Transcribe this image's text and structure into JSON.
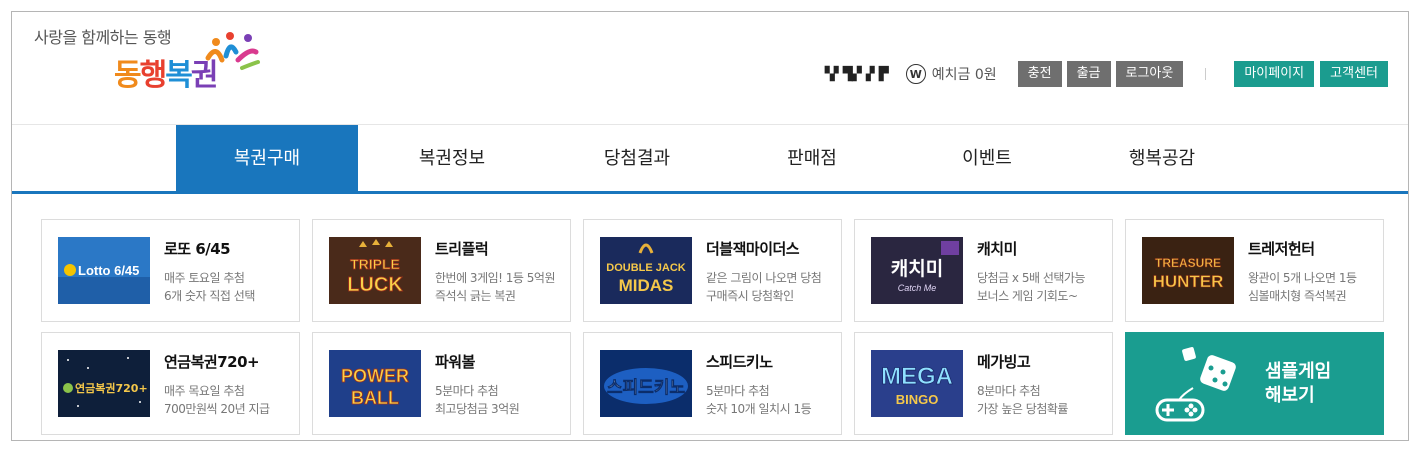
{
  "header": {
    "slogan": "사랑을 함께하는 동행",
    "brand": [
      "동",
      "행",
      "복",
      "권"
    ],
    "user_name": "▚▘▜▞▗▘▛",
    "deposit_icon": "W",
    "deposit_label": "예치금 0원",
    "buttons": [
      "충전",
      "출금",
      "로그아웃"
    ],
    "links": [
      "마이페이지",
      "고객센터"
    ]
  },
  "nav": {
    "items": [
      "복권구매",
      "복권정보",
      "당첨결과",
      "판매점",
      "이벤트",
      "행복공감"
    ],
    "active_index": 0,
    "accent_color": "#1976bd"
  },
  "games": [
    {
      "title": "로또 6/45",
      "line1": "매주 토요일 추첨",
      "line2": "6개 숫자 직접 선택",
      "logo_text": "Lotto 6/45"
    },
    {
      "title": "트리플럭",
      "line1": "한번에 3게임! 1등 5억원",
      "line2": "즉석식 긁는 복권",
      "logo_text": [
        "TRIPLE",
        "LUCK"
      ]
    },
    {
      "title": "더블잭마이더스",
      "line1": "같은 그림이 나오면 당첨",
      "line2": "구매즉시 당첨확인",
      "logo_text": [
        "DOUBLE JACK",
        "MIDAS"
      ]
    },
    {
      "title": "캐치미",
      "line1": "당첨금 x 5배 선택가능",
      "line2": "보너스 게임 기회도~",
      "logo_text": [
        "캐치미",
        "Catch Me"
      ]
    },
    {
      "title": "트레저헌터",
      "line1": "왕관이 5개 나오면 1등",
      "line2": "심볼매치형 즉석복권",
      "logo_text": [
        "TREASURE",
        "HUNTER"
      ]
    },
    {
      "title": "연금복권720+",
      "line1": "매주 목요일 추첨",
      "line2": "700만원씩 20년 지급",
      "logo_text": "연금복권720+"
    },
    {
      "title": "파워볼",
      "line1": "5분마다 추첨",
      "line2": "최고당첨금 3억원",
      "logo_text": [
        "POWER",
        "BALL"
      ]
    },
    {
      "title": "스피드키노",
      "line1": "5분마다 추첨",
      "line2": "숫자 10개 일치시 1등",
      "logo_text": "스피드키노"
    },
    {
      "title": "메가빙고",
      "line1": "8분마다 추첨",
      "line2": "가장 높은 당첨확률",
      "logo_text": [
        "MEGA",
        "BINGO"
      ]
    }
  ],
  "sample": {
    "line1": "샘플게임",
    "line2": "해보기",
    "color": "#1a9d90"
  }
}
